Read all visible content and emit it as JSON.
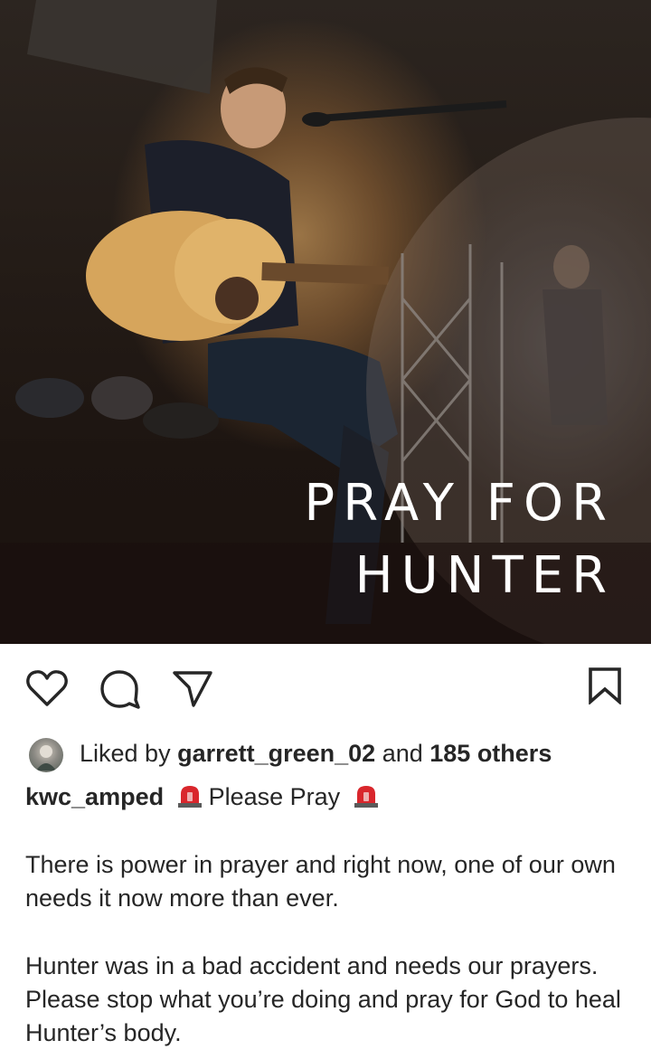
{
  "post": {
    "image": {
      "headline_line1": "PRAY FOR",
      "headline_line2": "HUNTER"
    },
    "actions": {
      "like_icon": "heart-icon",
      "comment_icon": "comment-icon",
      "share_icon": "send-icon",
      "save_icon": "bookmark-icon"
    },
    "likes": {
      "prefix": "Liked by ",
      "user": "garrett_green_02",
      "middle": " and ",
      "others": "185 others"
    },
    "caption": {
      "username": "kwc_amped",
      "text": "Please Pray",
      "emoji": "police-car-light",
      "paragraph1": "There is power in prayer and right now, one of our own needs it now more than ever.",
      "paragraph2": "Hunter was in a bad accident and needs our prayers. Please stop what you’re doing and pray for God to heal Hunter’s body."
    }
  },
  "colors": {
    "text": "#262626",
    "siren_red": "#d9262c"
  }
}
